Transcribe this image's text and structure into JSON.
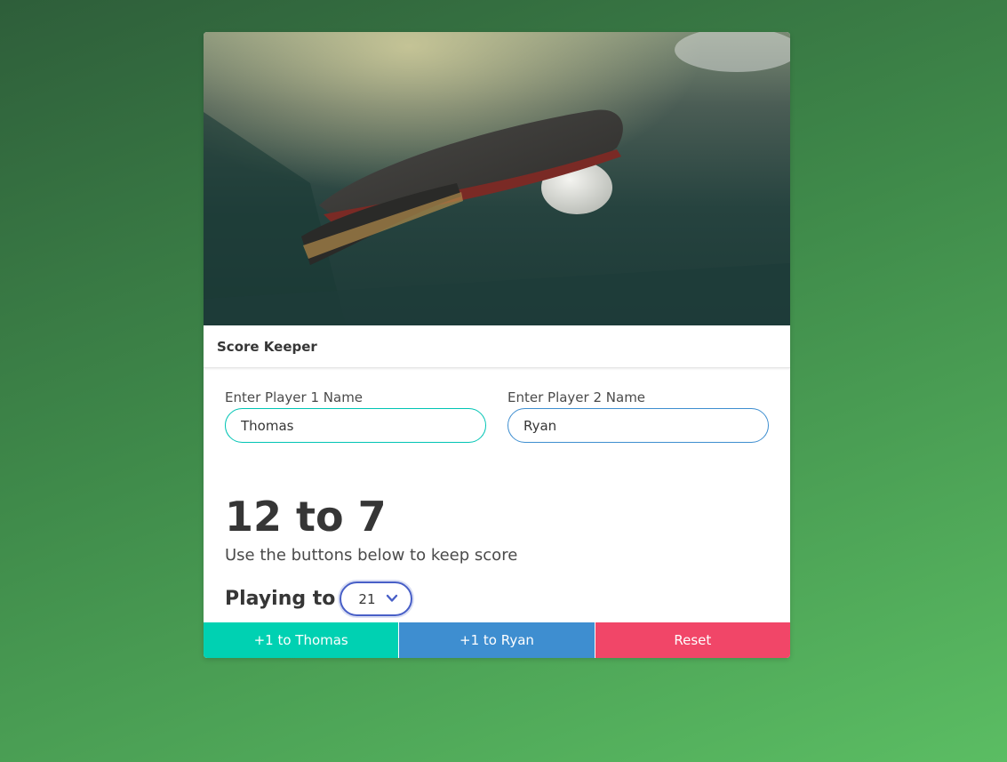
{
  "card": {
    "image_alt": "Ping pong paddle and ball on table",
    "title": "Score Keeper"
  },
  "form": {
    "player1": {
      "label": "Enter Player 1 Name",
      "value": "Thomas"
    },
    "player2": {
      "label": "Enter Player 2 Name",
      "value": "Ryan"
    }
  },
  "scoreboard": {
    "score_text": "12 to 7",
    "player1_score": 12,
    "player2_score": 7,
    "subtitle": "Use the buttons below to keep score"
  },
  "playing_to": {
    "label": "Playing to",
    "selected": "21"
  },
  "buttons": {
    "player1": "+1 to Thomas",
    "player2": "+1 to Ryan",
    "reset": "Reset"
  },
  "colors": {
    "player1_accent": "#00d1b2",
    "player2_accent": "#3e8ed0",
    "reset_accent": "#f14668",
    "select_focus": "#485fc7"
  },
  "icons": {
    "select_arrow": "chevron-down-icon"
  }
}
